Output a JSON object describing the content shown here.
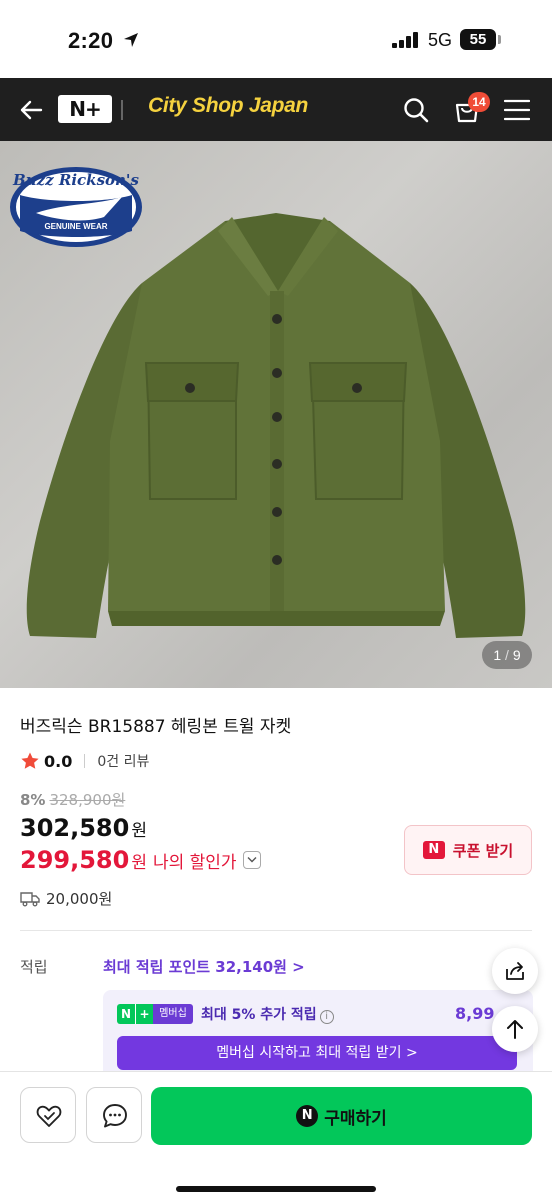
{
  "status": {
    "time": "2:20",
    "network": "5G",
    "battery": "55"
  },
  "header": {
    "logo": "N+",
    "title": "City Shop Japan",
    "cart_count": "14"
  },
  "image": {
    "brand_logo_text": "Buzz Rickson's",
    "brand_logo_sub": "GENUINE WEAR",
    "current": "1",
    "separator": "/",
    "total": "9"
  },
  "product": {
    "name": "버즈릭슨 BR15887 헤링본 트윌 자켓",
    "rating": "0.0",
    "review_count": "0건 리뷰",
    "discount_rate": "8%",
    "original_price": "328,900원",
    "price": "302,580",
    "my_price": "299,580",
    "won": "원",
    "my_price_label": "나의 할인가",
    "coupon_label": "쿠폰 받기",
    "coupon_icon": "N",
    "shipping_fee": "20,000원"
  },
  "points": {
    "label": "적립",
    "max": "최대 적립 포인트 32,140원 >",
    "membership_badge_n": "N",
    "membership_badge_plus": "+",
    "membership_badge_text": "멤버십",
    "membership_extra": "최대 5% 추가 적립",
    "info_mark": "i",
    "membership_amount": "8,99",
    "membership_cta": "멤버십 시작하고 최대 적립 받기 >"
  },
  "bottom": {
    "buy_icon": "N",
    "buy_label": "구매하기"
  },
  "colors": {
    "header_bg": "#1f1f1f",
    "title": "#f5d23f",
    "accent_red": "#e3173a",
    "naver_green": "#03c75a",
    "purple": "#6b3bd4"
  }
}
